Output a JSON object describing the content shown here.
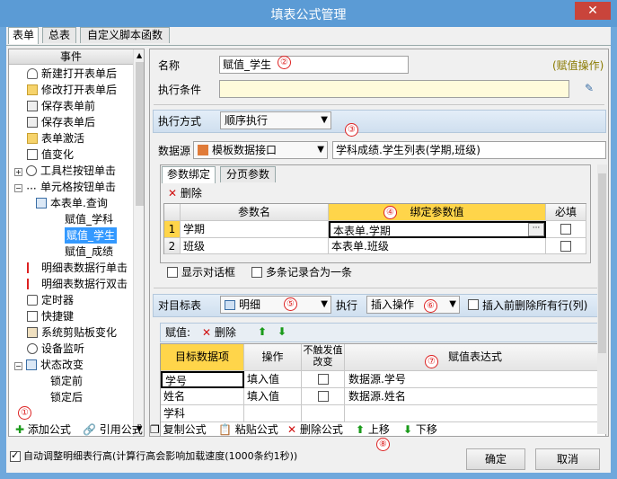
{
  "window": {
    "title": "填表公式管理",
    "close": "✕"
  },
  "tabs": [
    "表单",
    "总表",
    "自定义脚本函数"
  ],
  "events": {
    "header": "事件",
    "items": [
      "新建打开表单后",
      "修改打开表单后",
      "保存表单前",
      "保存表单后",
      "表单激活",
      "值变化",
      "工具栏按钮单击",
      "单元格按钮单击",
      "本表单.查询",
      "赋值_学科",
      "赋值_学生",
      "赋值_成绩",
      "明细表数据行单击",
      "明细表数据行双击",
      "定时器",
      "快捷键",
      "系统剪贴板变化",
      "设备监听",
      "状态改变",
      "锁定前",
      "锁定后"
    ]
  },
  "form": {
    "name_label": "名称",
    "name_value": "赋值_学生",
    "op_type": "(赋值操作)",
    "cond_label": "执行条件",
    "exec_mode_label": "执行方式",
    "exec_mode_value": "顺序执行",
    "ds_label": "数据源",
    "ds_value": "模板数据接口",
    "ds_desc": "学科成绩.学生列表(学期,班级)"
  },
  "param_tabs": [
    "参数绑定",
    "分页参数"
  ],
  "delete_label": "删除",
  "param_table": {
    "headers": [
      "参数名",
      "绑定参数值",
      "必填"
    ],
    "rows": [
      {
        "no": "1",
        "name": "学期",
        "value": "本表单.学期"
      },
      {
        "no": "2",
        "name": "班级",
        "value": "本表单.班级"
      }
    ]
  },
  "options": {
    "show_dialog": "显示对话框",
    "merge": "多条记录合为一条"
  },
  "target": {
    "label": "对目标表",
    "value": "明细",
    "exec_label": "执行",
    "exec_value": "插入操作",
    "clear_label": "插入前删除所有行(列)"
  },
  "assign_label": "赋值:",
  "assign_table": {
    "headers": [
      "目标数据项",
      "操作",
      "不触发值改变",
      "赋值表达式"
    ],
    "rows": [
      {
        "item": "学号",
        "op": "填入值",
        "expr": "数据源.学号"
      },
      {
        "item": "姓名",
        "op": "填入值",
        "expr": "数据源.姓名"
      },
      {
        "item": "学科",
        "op": "",
        "expr": ""
      }
    ]
  },
  "toolbar": {
    "add": "添加公式",
    "ref": "引用公式",
    "copy": "复制公式",
    "paste": "粘贴公式",
    "del": "删除公式",
    "up": "上移",
    "down": "下移"
  },
  "footer": {
    "auto_adjust": "自动调整明细表行高(计算行高会影响加载速度(1000条约1秒))",
    "ok": "确定",
    "cancel": "取消"
  },
  "markers": [
    "①",
    "②",
    "③",
    "④",
    "⑤",
    "⑥",
    "⑦",
    "⑧"
  ]
}
